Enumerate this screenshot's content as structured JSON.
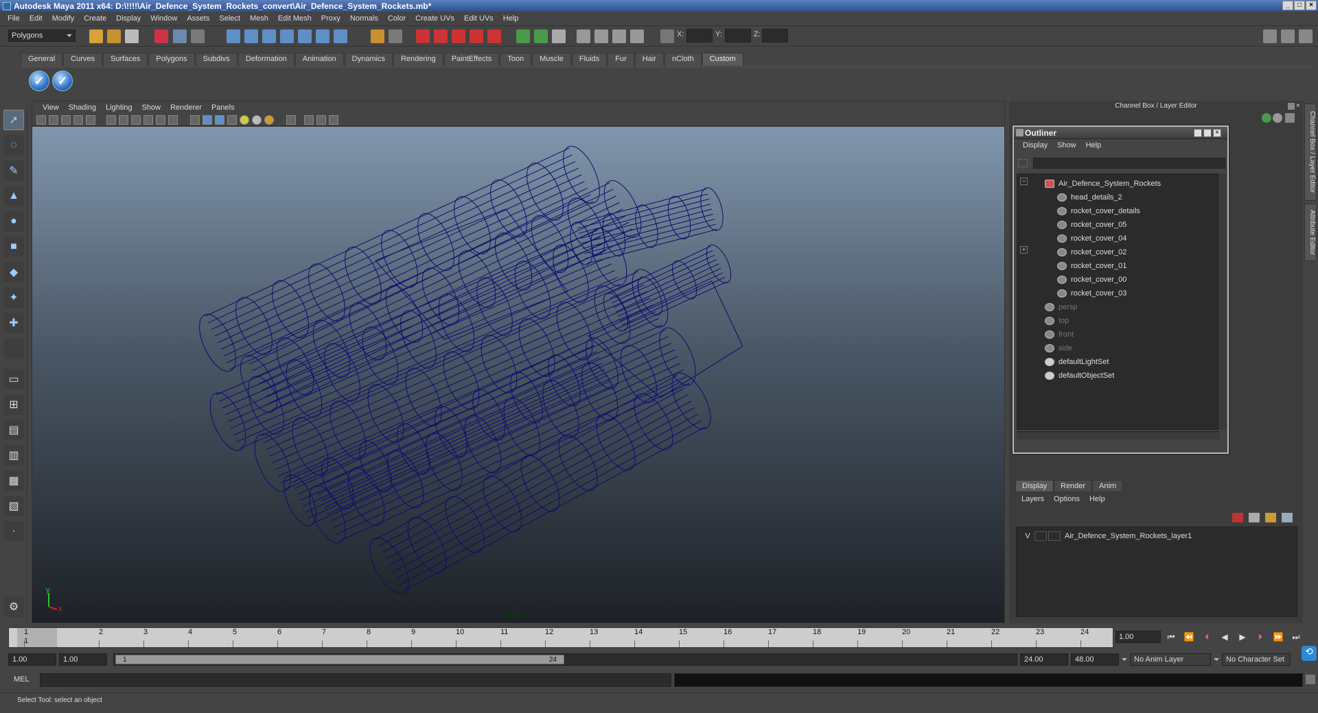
{
  "window": {
    "title": "Autodesk Maya 2011 x64: D:\\!!!!\\Air_Defence_System_Rockets_convert\\Air_Defence_System_Rockets.mb*"
  },
  "menubar": [
    "File",
    "Edit",
    "Modify",
    "Create",
    "Display",
    "Window",
    "Assets",
    "Select",
    "Mesh",
    "Edit Mesh",
    "Proxy",
    "Normals",
    "Color",
    "Create UVs",
    "Edit UVs",
    "Help"
  ],
  "statusline": {
    "mode": "Polygons",
    "x_label": "X:",
    "y_label": "Y:",
    "z_label": "Z:"
  },
  "shelf": {
    "tabs": [
      "General",
      "Curves",
      "Surfaces",
      "Polygons",
      "Subdivs",
      "Deformation",
      "Animation",
      "Dynamics",
      "Rendering",
      "PaintEffects",
      "Toon",
      "Muscle",
      "Fluids",
      "Fur",
      "Hair",
      "nCloth",
      "Custom"
    ],
    "active_tab": "Custom"
  },
  "viewport": {
    "menu": [
      "View",
      "Shading",
      "Lighting",
      "Show",
      "Renderer",
      "Panels"
    ],
    "camera": "persp",
    "axis_x": "x",
    "axis_y": "y"
  },
  "channelbox": {
    "title": "Channel Box / Layer Editor"
  },
  "sidetabs": [
    "Channel Box / Layer Editor",
    "Attribute Editor"
  ],
  "outliner": {
    "title": "Outliner",
    "menu": [
      "Display",
      "Show",
      "Help"
    ],
    "items": [
      {
        "label": "Air_Defence_System_Rockets",
        "indent": 0,
        "type": "mesh",
        "expander": "−"
      },
      {
        "label": "head_details_2",
        "indent": 1,
        "type": "mesh"
      },
      {
        "label": "rocket_cover_details",
        "indent": 1,
        "type": "mesh"
      },
      {
        "label": "rocket_cover_05",
        "indent": 1,
        "type": "mesh"
      },
      {
        "label": "rocket_cover_04",
        "indent": 1,
        "type": "mesh"
      },
      {
        "label": "rocket_cover_02",
        "indent": 1,
        "type": "mesh",
        "expander": "+"
      },
      {
        "label": "rocket_cover_01",
        "indent": 1,
        "type": "mesh"
      },
      {
        "label": "rocket_cover_00",
        "indent": 1,
        "type": "mesh"
      },
      {
        "label": "rocket_cover_03",
        "indent": 1,
        "type": "mesh"
      },
      {
        "label": "persp",
        "indent": 0,
        "type": "camera"
      },
      {
        "label": "top",
        "indent": 0,
        "type": "camera"
      },
      {
        "label": "front",
        "indent": 0,
        "type": "camera"
      },
      {
        "label": "side",
        "indent": 0,
        "type": "camera"
      },
      {
        "label": "defaultLightSet",
        "indent": 0,
        "type": "set"
      },
      {
        "label": "defaultObjectSet",
        "indent": 0,
        "type": "set"
      }
    ]
  },
  "layereditor": {
    "tabs": [
      "Display",
      "Render",
      "Anim"
    ],
    "active_tab": "Display",
    "menu": [
      "Layers",
      "Options",
      "Help"
    ],
    "layers": [
      {
        "visible": "V",
        "name": "Air_Defence_System_Rockets_layer1"
      }
    ]
  },
  "timeline": {
    "frames": [
      "1",
      "2",
      "3",
      "4",
      "5",
      "6",
      "7",
      "8",
      "9",
      "10",
      "11",
      "12",
      "13",
      "14",
      "15",
      "16",
      "17",
      "18",
      "19",
      "20",
      "21",
      "22",
      "23",
      "24"
    ],
    "current_frame_marker": "1",
    "current_frame": "1.00"
  },
  "range": {
    "start": "1.00",
    "playback_start": "1.00",
    "slider_start": "1",
    "slider_end": "24",
    "playback_end": "24.00",
    "end": "48.00",
    "anim_layer": "No Anim Layer",
    "character_set": "No Character Set"
  },
  "commandline": {
    "label": "MEL"
  },
  "helpline": {
    "text": "Select Tool: select an object"
  },
  "colors": {
    "wireframe": "#0d0d6e",
    "accent": "#2f74c8"
  }
}
